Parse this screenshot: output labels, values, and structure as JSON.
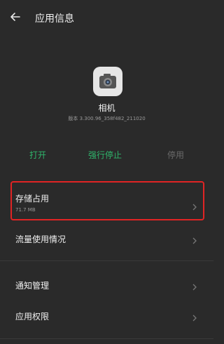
{
  "header": {
    "title": "应用信息",
    "back_icon": "back-arrow-icon"
  },
  "app": {
    "name": "相机",
    "version": "版本 3.300.96_358f482_211020",
    "icon": "camera-icon"
  },
  "actions": {
    "open": "打开",
    "force_stop": "强行停止",
    "disable": "停用",
    "colors": {
      "enabled": "#2fb56b",
      "disabled": "#6a6a6a"
    }
  },
  "settings": {
    "storage": {
      "label": "存储占用",
      "value": "71.7 MB"
    },
    "data_usage": {
      "label": "流量使用情况"
    },
    "notifications": {
      "label": "通知管理"
    },
    "permissions": {
      "label": "应用权限"
    }
  },
  "highlight_color": "#e02424"
}
